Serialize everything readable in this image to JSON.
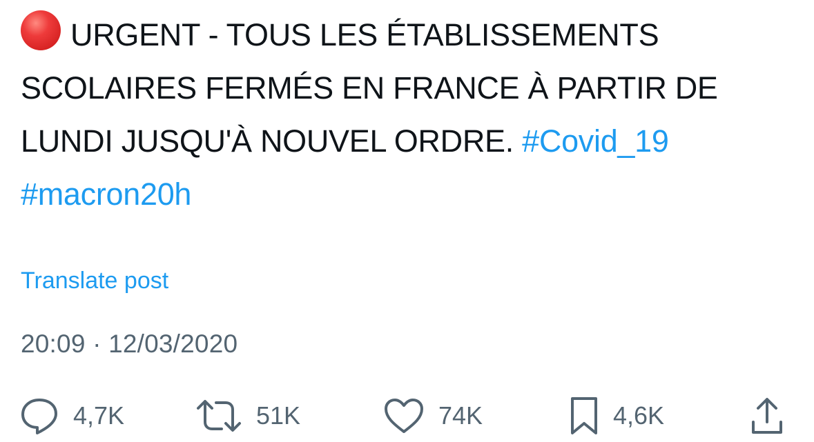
{
  "post": {
    "text_main": "URGENT - TOUS LES ÉTABLISSEMENTS SCOLAIRES FERMÉS EN FRANCE À PARTIR DE LUNDI JUSQU'À NOUVEL ORDRE.",
    "hashtags": [
      "#Covid_19",
      "#macron20h"
    ],
    "status_emoji": "red-circle-icon",
    "translate_label": "Translate post",
    "timestamp": "20:09 · 12/03/2020"
  },
  "actions": {
    "replies": "4,7K",
    "reposts": "51K",
    "likes": "74K",
    "bookmarks": "4,6K"
  },
  "colors": {
    "link": "#1d9bf0",
    "text": "#0f1419",
    "muted": "#536471",
    "status_dot": "#e0302f"
  }
}
